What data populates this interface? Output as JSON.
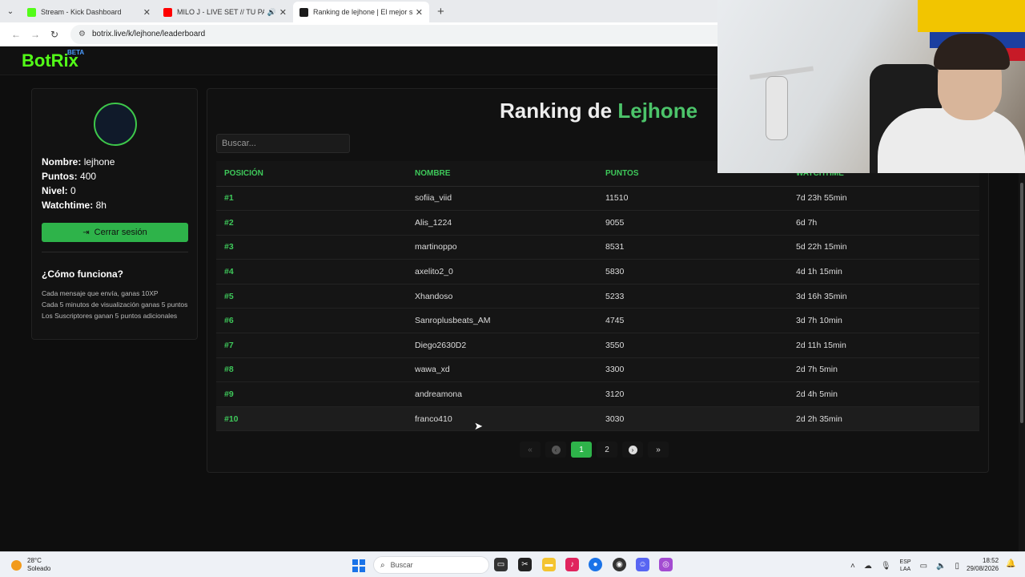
{
  "browser": {
    "tabs": [
      {
        "title": "Stream - Kick Dashboard",
        "favicon_color": "#53fc18",
        "active": false
      },
      {
        "title": "MILO J - LIVE SET // TU PAZ",
        "favicon_color": "#ff0000",
        "active": false
      },
      {
        "title": "Ranking de lejhone | El mejor s",
        "favicon_color": "#1b1b1b",
        "active": true
      }
    ],
    "new_tab": "+",
    "url": "botrix.live/k/lejhone/leaderboard"
  },
  "site": {
    "logo": "BotRix",
    "badge": "BETA"
  },
  "profile": {
    "fields": [
      {
        "label": "Nombre:",
        "value": "lejhone"
      },
      {
        "label": "Puntos:",
        "value": "400"
      },
      {
        "label": "Nivel:",
        "value": "0"
      },
      {
        "label": "Watchtime:",
        "value": "8h"
      }
    ],
    "logout_label": "Cerrar sesión",
    "how_title": "¿Cómo funciona?",
    "how_items": [
      "Cada mensaje que envía, ganas 10XP",
      "Cada 5 minutos de visualización ganas 5 puntos",
      "Los Suscriptores ganan 5 puntos adicionales"
    ]
  },
  "ranking": {
    "title_prefix": "Ranking de ",
    "title_name": "Lejhone",
    "search_placeholder": "Buscar...",
    "columns": [
      "POSICIÓN",
      "NOMBRE",
      "PUNTOS",
      "WATCHTIME"
    ],
    "rows": [
      {
        "pos": "#1",
        "name": "sofiia_viid",
        "points": "11510",
        "watch": "7d 23h 55min"
      },
      {
        "pos": "#2",
        "name": "Alis_1224",
        "points": "9055",
        "watch": "6d 7h"
      },
      {
        "pos": "#3",
        "name": "martinoppo",
        "points": "8531",
        "watch": "5d 22h 15min"
      },
      {
        "pos": "#4",
        "name": "axelito2_0",
        "points": "5830",
        "watch": "4d 1h 15min"
      },
      {
        "pos": "#5",
        "name": "Xhandoso",
        "points": "5233",
        "watch": "3d 16h 35min"
      },
      {
        "pos": "#6",
        "name": "Sanroplusbeats_AM",
        "points": "4745",
        "watch": "3d 7h 10min"
      },
      {
        "pos": "#7",
        "name": "Diego2630D2",
        "points": "3550",
        "watch": "2d 11h 15min"
      },
      {
        "pos": "#8",
        "name": "wawa_xd",
        "points": "3300",
        "watch": "2d 7h 5min"
      },
      {
        "pos": "#9",
        "name": "andreamona",
        "points": "3120",
        "watch": "2d 4h 5min"
      },
      {
        "pos": "#10",
        "name": "franco410",
        "points": "3030",
        "watch": "2d 2h 35min"
      }
    ],
    "pagination": {
      "first": "«",
      "prev": "‹",
      "pages": [
        "1",
        "2"
      ],
      "current": "1",
      "next": "›",
      "last": "»"
    }
  },
  "taskbar": {
    "temp": "28°C",
    "weather": "Soleado",
    "search": "Buscar",
    "lang_top": "ESP",
    "lang_bottom": "LAA",
    "time": "18:52",
    "date": "29/08/2026"
  }
}
